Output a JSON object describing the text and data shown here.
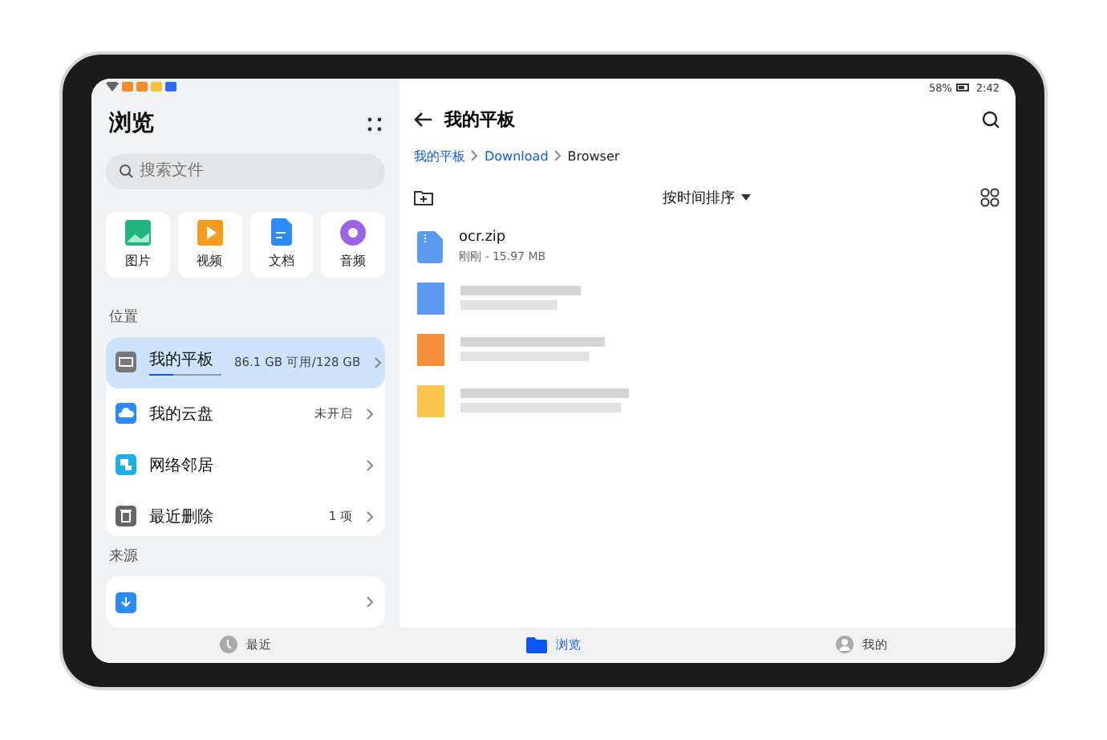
{
  "status_bar": {
    "battery": "58%",
    "time": "2:42"
  },
  "sidebar": {
    "title": "浏览",
    "search": {
      "placeholder": "搜索文件"
    },
    "categories": [
      {
        "label": "图片",
        "kind": "image"
      },
      {
        "label": "视频",
        "kind": "video"
      },
      {
        "label": "文档",
        "kind": "doc"
      },
      {
        "label": "音频",
        "kind": "audio"
      }
    ],
    "sections": [
      {
        "title": "位置",
        "items": [
          {
            "label": "我的平板",
            "detail": "86.1 GB 可用/128 GB",
            "selected": true,
            "kind": "tablet",
            "level": 0.33
          },
          {
            "label": "我的云盘",
            "detail": "未开启",
            "selected": false,
            "kind": "cloud"
          },
          {
            "label": "网络邻居",
            "selected": false,
            "kind": "network"
          },
          {
            "label": "最近删除",
            "detail": "1 项",
            "selected": false,
            "kind": "trash"
          }
        ]
      },
      {
        "title": "来源",
        "items": [
          {
            "selected": false,
            "kind": "download"
          }
        ]
      }
    ]
  },
  "main": {
    "title": "我的平板",
    "breadcrumb": [
      {
        "label": "我的平板",
        "link": true
      },
      {
        "label": "Download",
        "link": true
      },
      {
        "label": "Browser",
        "link": false
      }
    ],
    "sort": "按时间排序",
    "files": [
      {
        "kind": "zip",
        "name": "ocr.zip",
        "meta": "刚刚 - 15.97 MB"
      },
      {
        "kind": "blurred",
        "color": "#5b9cf0"
      },
      {
        "kind": "blurred",
        "color": "#f5913a"
      },
      {
        "kind": "blurred",
        "color": "#fbc64c"
      }
    ]
  },
  "bottom_nav": [
    {
      "label": "最近",
      "selected": false,
      "kind": "clock"
    },
    {
      "label": "浏览",
      "selected": true,
      "kind": "folder"
    },
    {
      "label": "我的",
      "selected": false,
      "kind": "person"
    }
  ]
}
